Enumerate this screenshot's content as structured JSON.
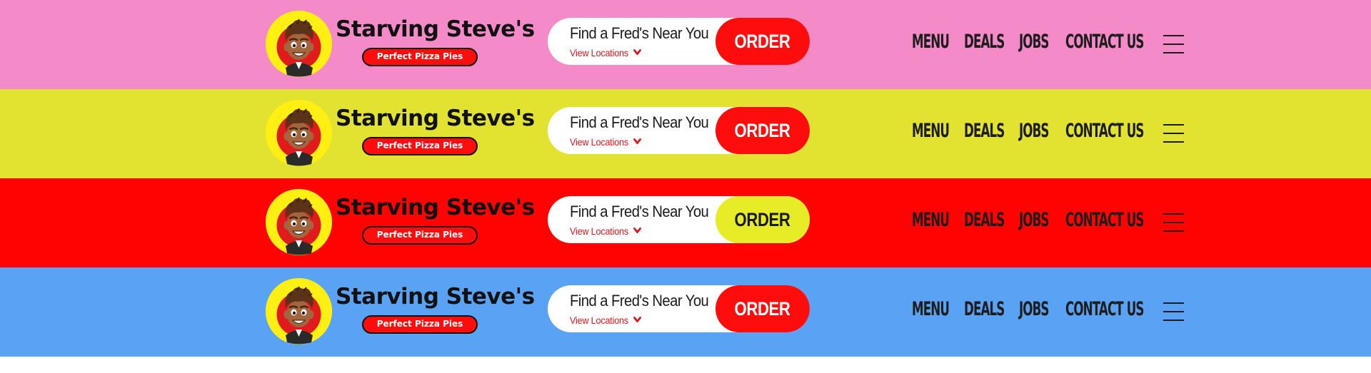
{
  "brand": {
    "name": "Starving Steve's",
    "tagline": "Perfect Pizza Pies",
    "logo_icon": "cartoon-chef-avatar",
    "colors": {
      "badge": "#ffef12",
      "tagline_bg": "#ff0d0d",
      "text": "#111111"
    }
  },
  "locator": {
    "title": "Find a Fred's Near You",
    "link_label": "View Locations",
    "link_icon": "chevron-down-icon",
    "link_color": "#e3141c"
  },
  "order": {
    "label": "ORDER"
  },
  "nav": {
    "items": [
      {
        "label": "MENU"
      },
      {
        "label": "DEALS"
      },
      {
        "label": "JOBS"
      },
      {
        "label": "CONTACT US"
      }
    ],
    "menu_icon": "hamburger-menu-icon"
  },
  "variants": [
    {
      "background": "#f58ac8",
      "order_bg": "#ff0d0d",
      "order_text": "#ffffff"
    },
    {
      "background": "#e2e330",
      "order_bg": "#ff0d0d",
      "order_text": "#ffffff"
    },
    {
      "background": "#ff0202",
      "order_bg": "#e6ec25",
      "order_text": "#1a1a1a"
    },
    {
      "background": "#5aa3f4",
      "order_bg": "#ff0d0d",
      "order_text": "#ffffff"
    }
  ]
}
